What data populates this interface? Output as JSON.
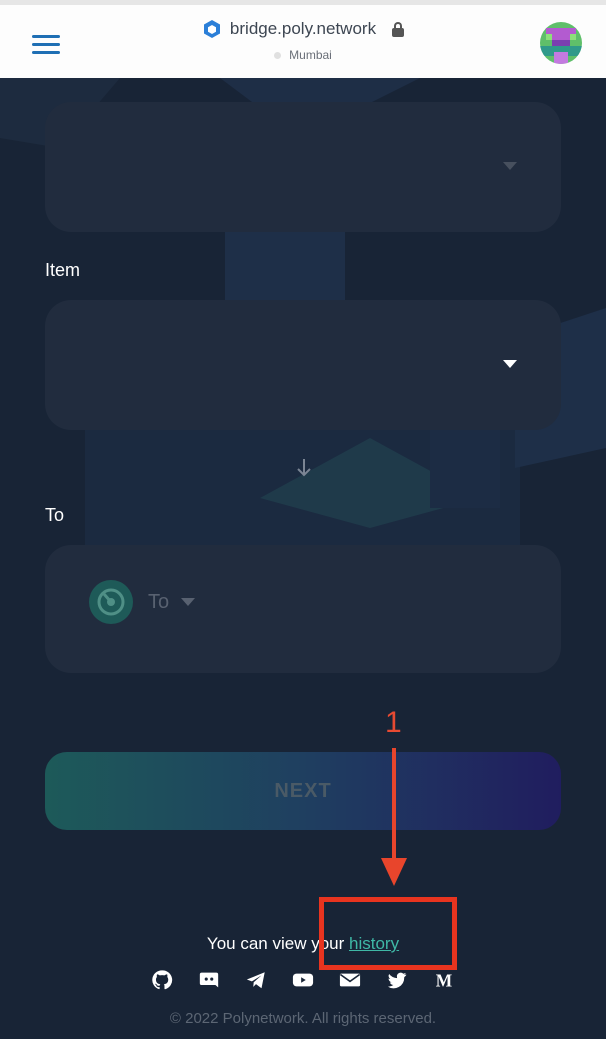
{
  "browser": {
    "url": "bridge.poly.network",
    "network": "Mumbai"
  },
  "form": {
    "item_label": "Item",
    "to_label": "To",
    "to_chain_placeholder": "To",
    "next_label": "NEXT"
  },
  "annotation": {
    "number": "1"
  },
  "history": {
    "prefix": "You can view your ",
    "link": "history"
  },
  "socials": [
    "github-icon",
    "discord-icon",
    "telegram-icon",
    "youtube-icon",
    "email-icon",
    "twitter-icon",
    "medium-icon"
  ],
  "footer": {
    "copyright": "© 2022 Polynetwork. All rights reserved."
  },
  "colors": {
    "background": "#182436",
    "panel": "#212c3e",
    "accent": "#3fb8a6",
    "annotation": "#e8452c"
  }
}
